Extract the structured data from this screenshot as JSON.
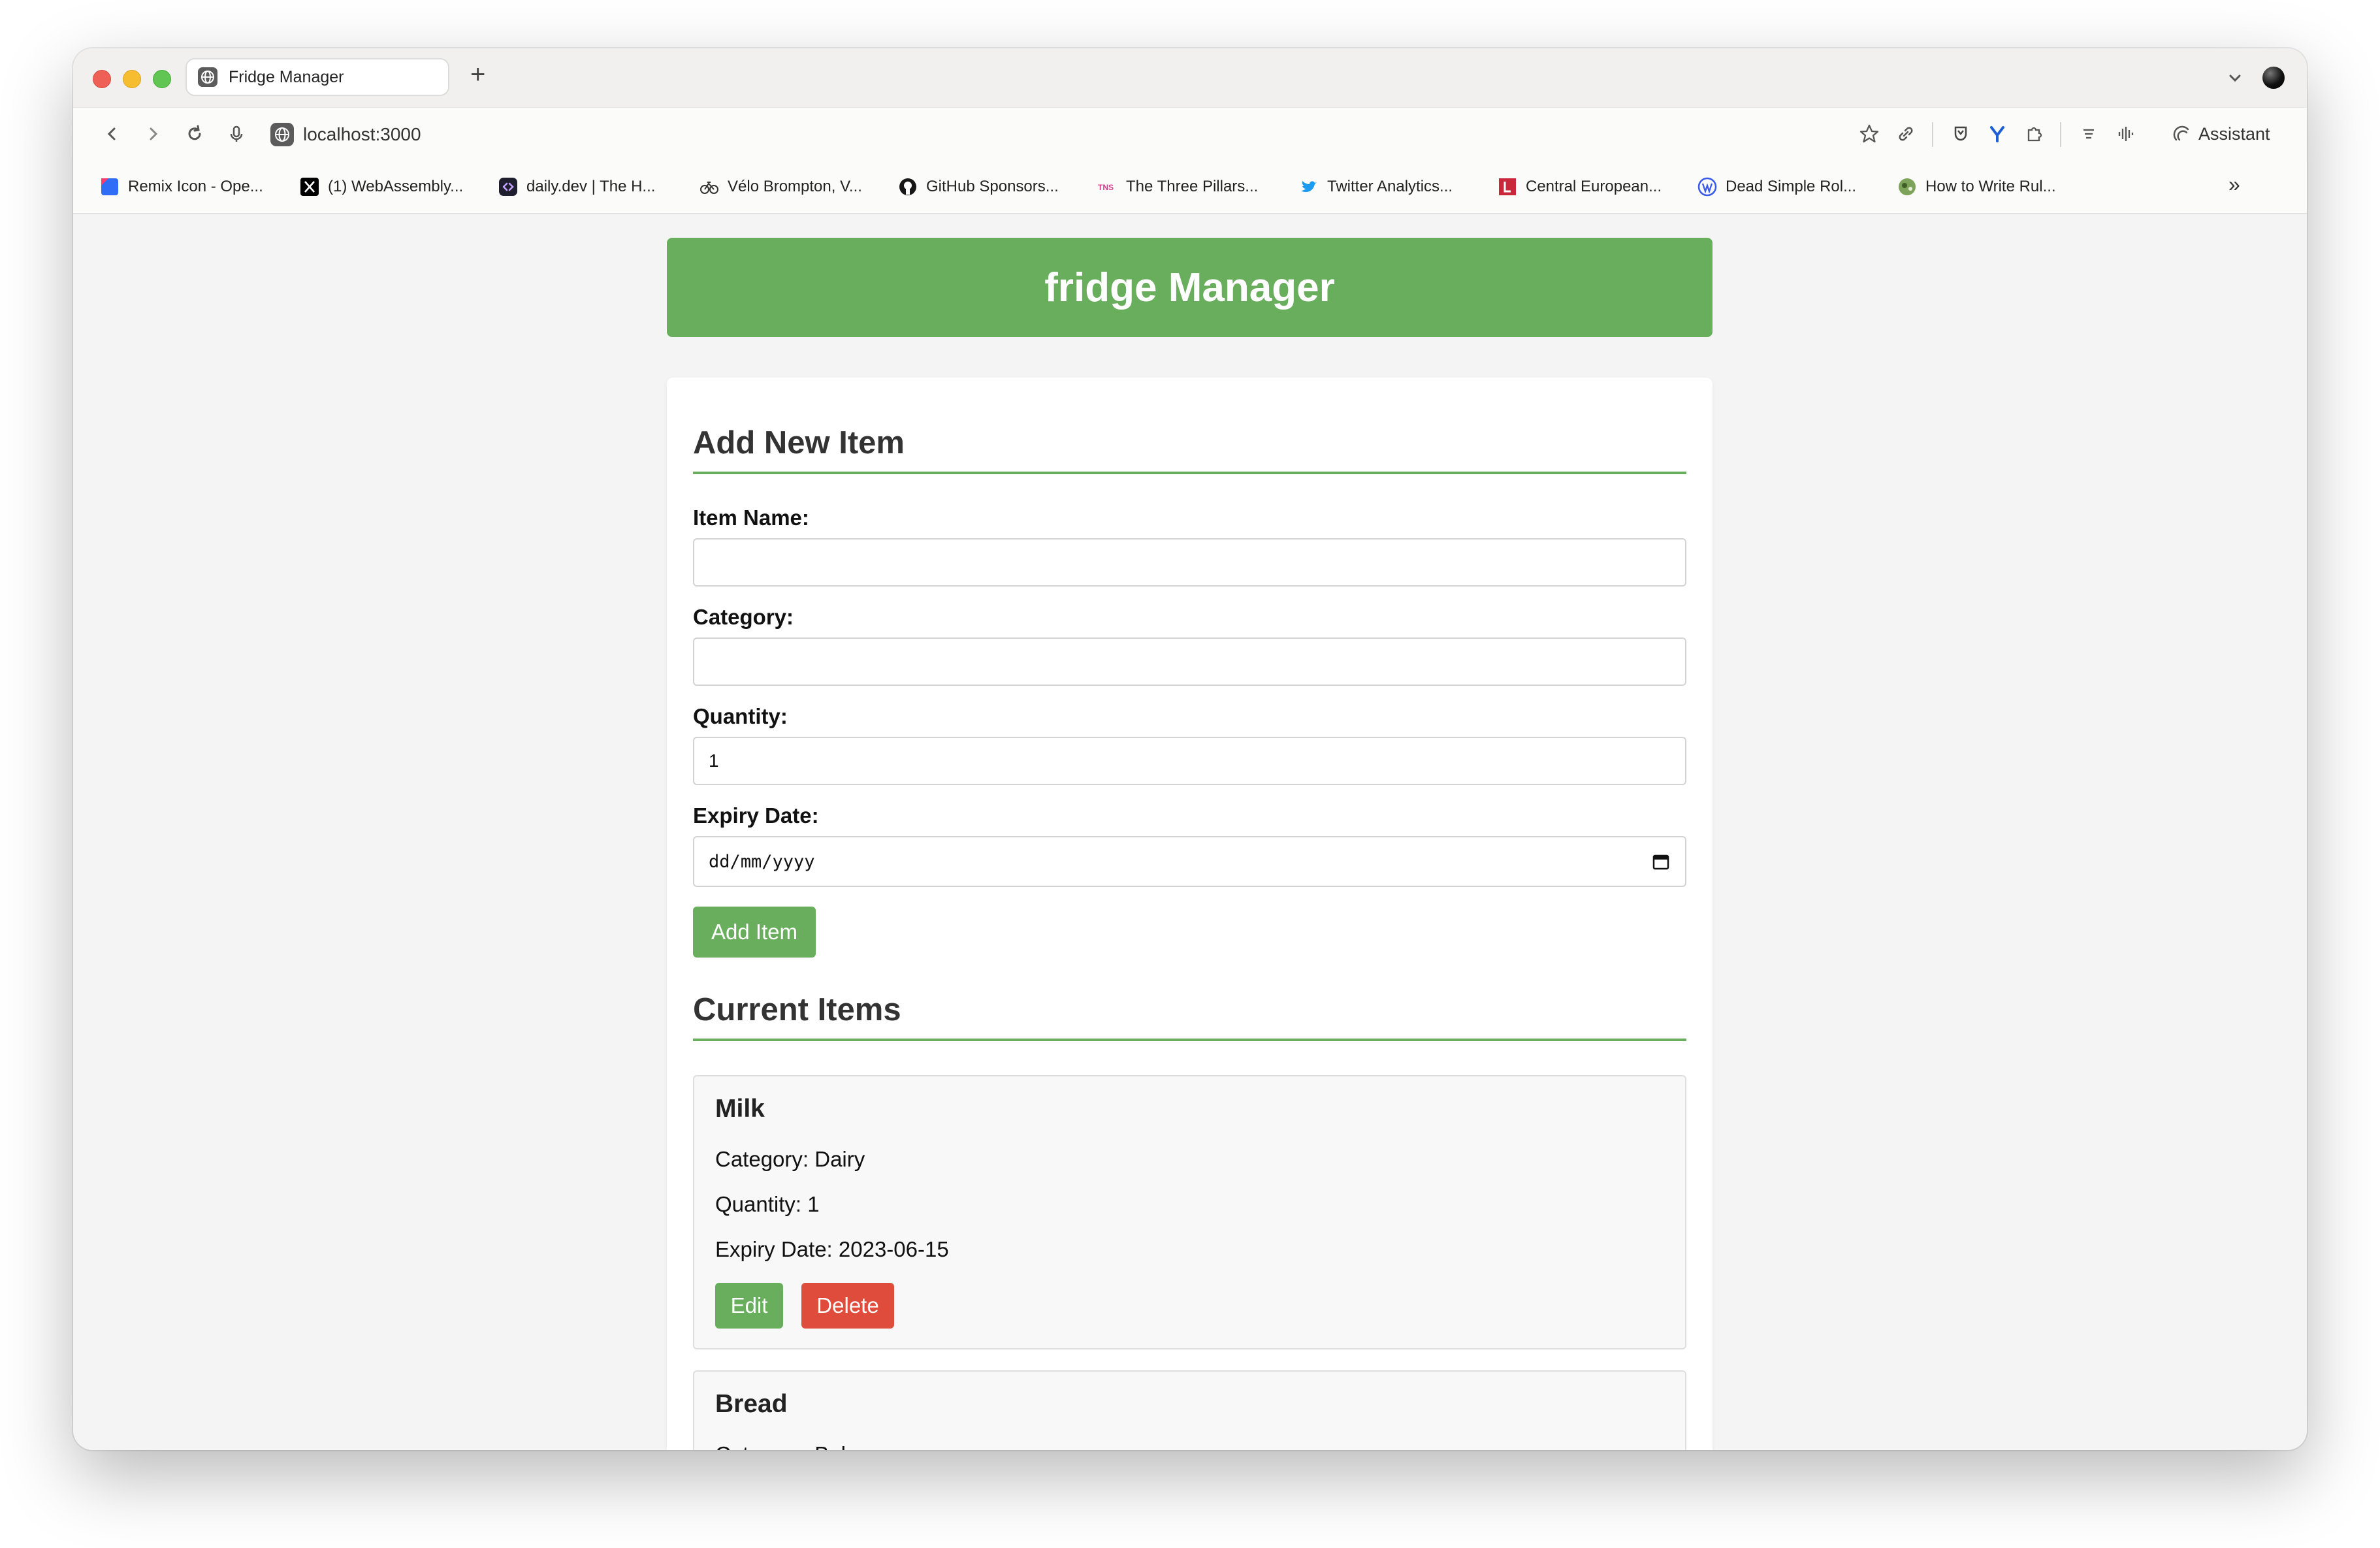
{
  "browser": {
    "tab_title": "Fridge Manager",
    "new_tab": "+",
    "url": "localhost:3000",
    "assistant_label": "Assistant",
    "bookmarks": [
      {
        "label": "Remix Icon - Ope...",
        "icon": "remix-icon",
        "color": "#2f6df6"
      },
      {
        "label": "(1) WebAssembly...",
        "icon": "x-icon",
        "color": "#000000"
      },
      {
        "label": "daily.dev | The H...",
        "icon": "dailydev-icon",
        "color": "#1e1e2e"
      },
      {
        "label": "Vélo Brompton, V...",
        "icon": "bicycle-icon",
        "color": "#333333"
      },
      {
        "label": "GitHub Sponsors...",
        "icon": "github-icon",
        "color": "#181717"
      },
      {
        "label": "The Three Pillars...",
        "icon": "tns-icon",
        "color": "#e0368d"
      },
      {
        "label": "Twitter Analytics...",
        "icon": "twitter-icon",
        "color": "#1d9bf0"
      },
      {
        "label": "Central European...",
        "icon": "l-icon",
        "color": "#c9273a"
      },
      {
        "label": "Dead Simple Rol...",
        "icon": "wordpress-icon",
        "color": "#3858e9"
      },
      {
        "label": "How to Write Rul...",
        "icon": "globe-green-icon",
        "color": "#5c8a3a"
      }
    ],
    "more_bookmarks": "»"
  },
  "page": {
    "header_title": "fridge Manager",
    "add_section_title": "Add New Item",
    "form": {
      "item_name_label": "Item Name:",
      "item_name_value": "",
      "category_label": "Category:",
      "category_value": "",
      "quantity_label": "Quantity:",
      "quantity_value": "1",
      "expiry_label": "Expiry Date:",
      "expiry_placeholder": "dd/mm/yyyy",
      "submit_label": "Add Item"
    },
    "current_section_title": "Current Items",
    "items": [
      {
        "name": "Milk",
        "category": "Category: Dairy",
        "quantity": "Quantity: 1",
        "expiry": "Expiry Date: 2023-06-15",
        "edit_label": "Edit",
        "delete_label": "Delete"
      },
      {
        "name": "Bread",
        "category": "Category: Bakery"
      }
    ]
  },
  "colors": {
    "accent_green": "#68ae5c",
    "delete_red": "#e04c3c"
  }
}
